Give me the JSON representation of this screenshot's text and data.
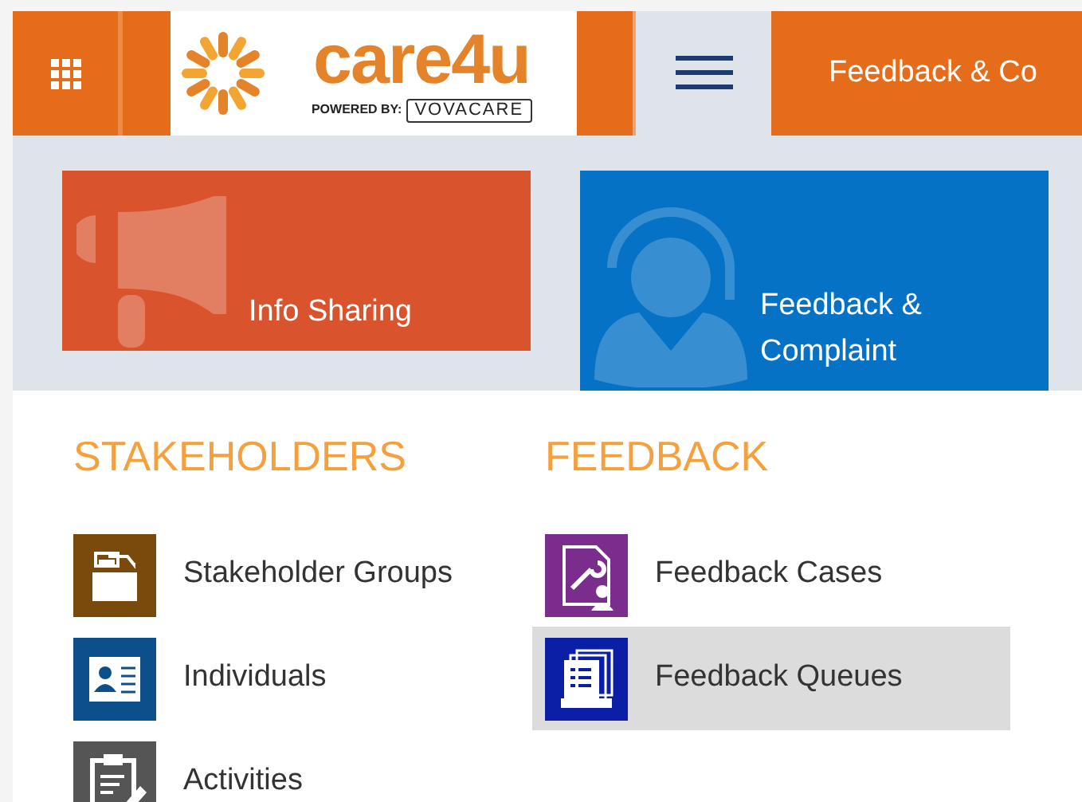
{
  "navbar": {
    "logo": {
      "brand": "care4u",
      "tagline": "POWERED BY:",
      "maker": "VOVACARE"
    },
    "area_tab": {
      "label": "Feedback & Co"
    }
  },
  "tiles": [
    {
      "label": "Info Sharing",
      "kind": "megaphone",
      "color": "#d9532c",
      "selected": false
    },
    {
      "label": "Feedback & Complaint",
      "kind": "agent",
      "color": "#0572c6",
      "selected": true
    }
  ],
  "groups": [
    {
      "title": "STAKEHOLDERS",
      "items": [
        {
          "label": "Stakeholder Groups",
          "kind": "folder",
          "color": "#7a4a0c",
          "selected": false
        },
        {
          "label": "Individuals",
          "kind": "card",
          "color": "#0c4f8a",
          "selected": false
        },
        {
          "label": "Activities",
          "kind": "clipboard",
          "color": "#555555",
          "selected": false
        }
      ]
    },
    {
      "title": "FEEDBACK",
      "items": [
        {
          "label": "Feedback Cases",
          "kind": "case",
          "color": "#7b2d8e",
          "selected": false
        },
        {
          "label": "Feedback Queues",
          "kind": "queue",
          "color": "#0a1ea6",
          "selected": true
        }
      ]
    }
  ]
}
